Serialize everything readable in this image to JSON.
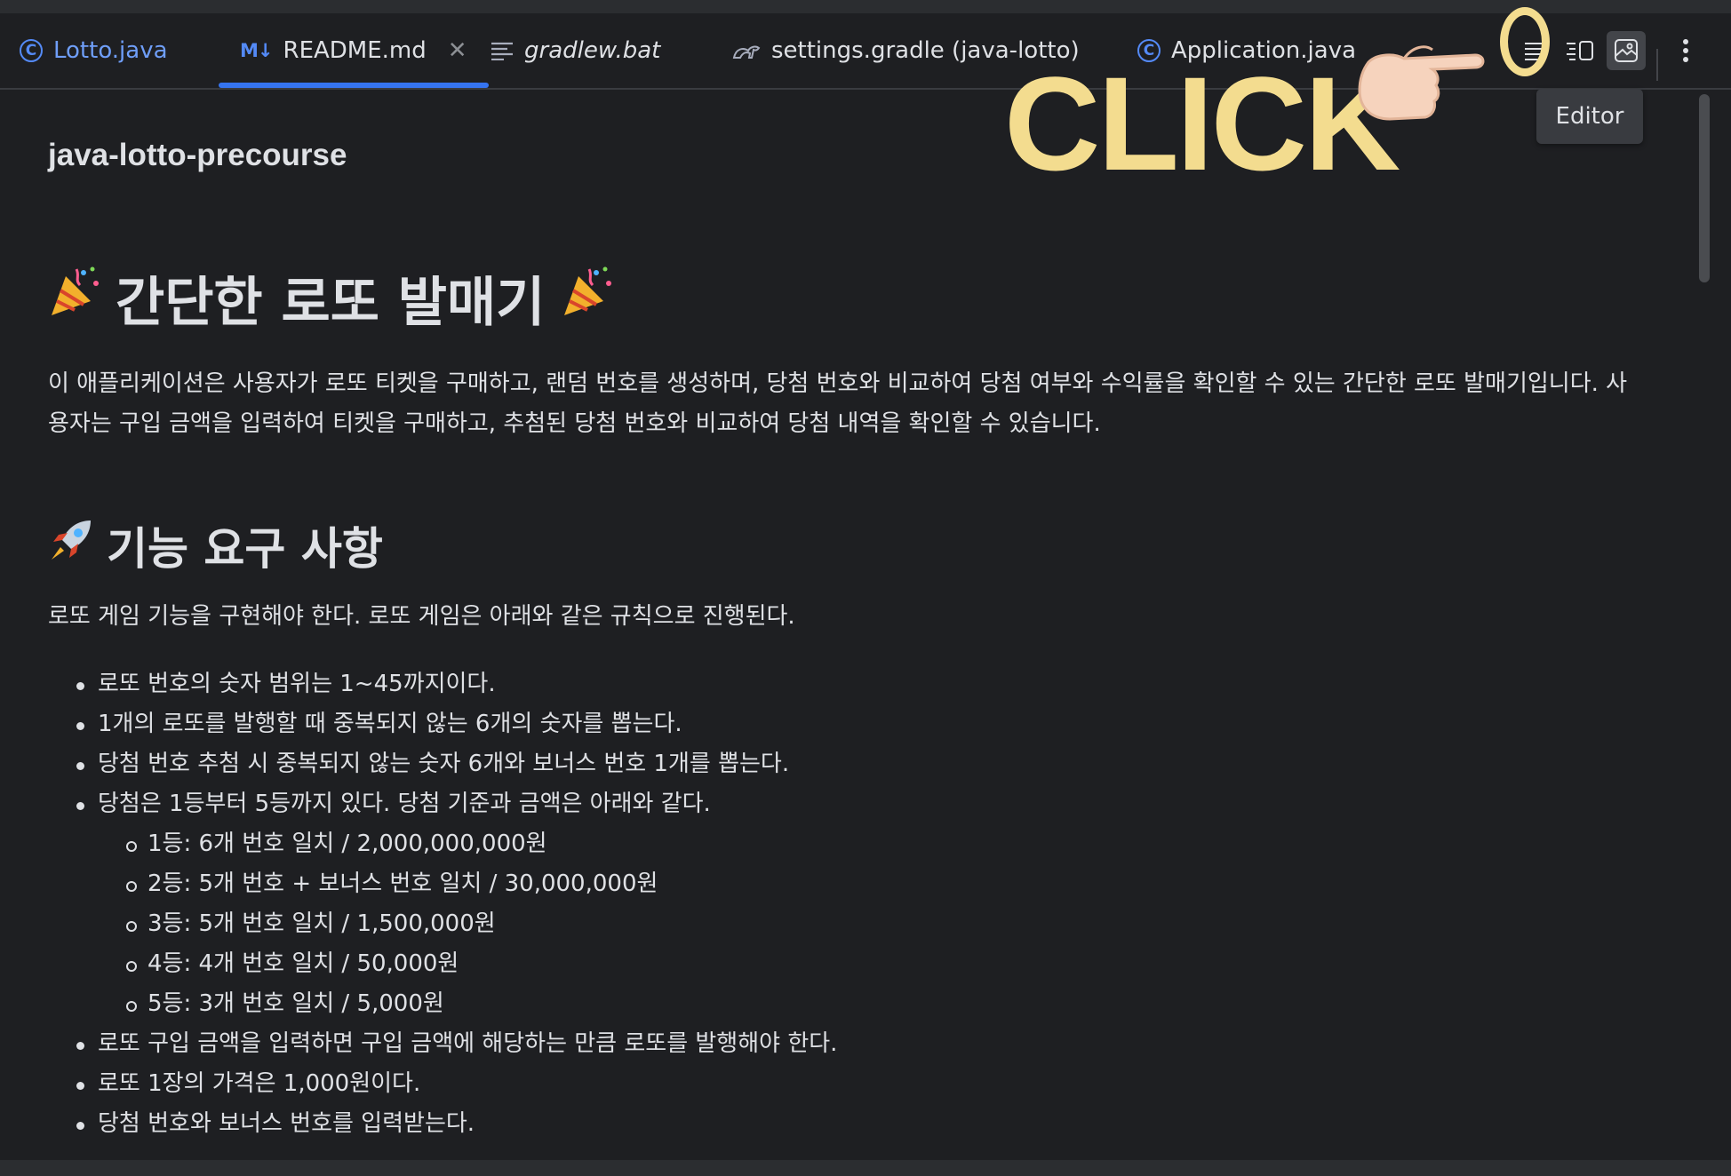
{
  "tabs": [
    {
      "label": "Lotto.java",
      "icon": "java-class-icon"
    },
    {
      "label": "README.md",
      "icon": "markdown-icon",
      "active": true
    },
    {
      "label": "gradlew.bat",
      "icon": "text-file-icon"
    },
    {
      "label": "settings.gradle (java-lotto)",
      "icon": "gradle-icon"
    },
    {
      "label": "Application.java",
      "icon": "java-class-icon"
    }
  ],
  "toolbar": {
    "editor_tooltip": "Editor",
    "md_badge": "M↓",
    "class_badge": "C"
  },
  "overlay": {
    "click_text": "CLICK"
  },
  "doc": {
    "project_title": "java-lotto-precourse",
    "h1": "간단한 로또 발매기",
    "intro_line1": "이 애플리케이션은 사용자가 로또 티켓을 구매하고, 랜덤 번호를 생성하며, 당첨 번호와 비교하여 당첨 여부와 수익률을 확인할 수 있는 간단한 로또 발매기입니다. 사",
    "intro_line2": "용자는 구입 금액을 입력하여 티켓을 구매하고, 추첨된 당첨 번호와 비교하여 당첨 내역을 확인할 수 있습니다.",
    "h2": "기능 요구 사항",
    "h2_desc": "로또 게임 기능을 구현해야 한다. 로또 게임은 아래와 같은 규칙으로 진행된다.",
    "list": [
      "로또 번호의 숫자 범위는 1~45까지이다.",
      "1개의 로또를 발행할 때 중복되지 않는 6개의 숫자를 뽑는다.",
      "당첨 번호 추첨 시 중복되지 않는 숫자 6개와 보너스 번호 1개를 뽑는다.",
      "당첨은 1등부터 5등까지 있다. 당첨 기준과 금액은 아래와 같다.",
      "1등: 6개 번호 일치 / 2,000,000,000원",
      "2등: 5개 번호 + 보너스 번호 일치 / 30,000,000원",
      "3등: 5개 번호 일치 / 1,500,000원",
      "4등: 4개 번호 일치 / 50,000원",
      "5등: 3개 번호 일치 / 5,000원",
      "로또 구입 금액을 입력하면 구입 금액에 해당하는 만큼 로또를 발행해야 한다.",
      "로또 1장의 가격은 1,000원이다.",
      "당첨 번호와 보너스 번호를 입력받는다."
    ]
  },
  "colors": {
    "accent": "#3574f0",
    "overlay": "#f3dc8f",
    "background": "#1e1f22"
  }
}
